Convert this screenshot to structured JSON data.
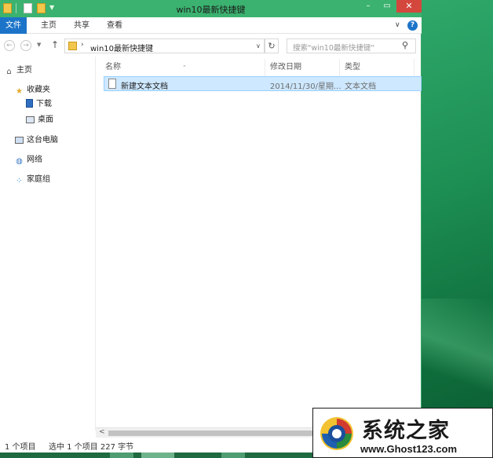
{
  "window": {
    "title": "win10最新快捷键",
    "controls": {
      "minimize": "–",
      "maximize": "▭",
      "close": "✕"
    },
    "accent": "#3bb26f"
  },
  "ribbon": {
    "tabs": [
      {
        "label": "文件",
        "active": true
      },
      {
        "label": "主页"
      },
      {
        "label": "共享"
      },
      {
        "label": "查看"
      }
    ],
    "expand_icon": "chevron-down-icon",
    "help_icon": "?"
  },
  "address_bar": {
    "path": "win10最新快捷键",
    "separator": "›",
    "search_placeholder": "搜索\"win10最新快捷键\""
  },
  "sidebar": {
    "items": [
      {
        "label": "主页",
        "icon": "home-icon"
      },
      {
        "label": "收藏夹",
        "icon": "star-icon"
      },
      {
        "label": "下载",
        "icon": "download-folder-icon"
      },
      {
        "label": "桌面",
        "icon": "desktop-icon"
      },
      {
        "label": "这台电脑",
        "icon": "computer-icon"
      },
      {
        "label": "网络",
        "icon": "network-icon"
      },
      {
        "label": "家庭组",
        "icon": "homegroup-icon"
      }
    ]
  },
  "file_list": {
    "columns": [
      "名称",
      "修改日期",
      "类型"
    ],
    "rows": [
      {
        "name": "新建文本文档",
        "date": "2014/11/30/星期...",
        "type": "文本文档",
        "selected": true
      }
    ]
  },
  "status_bar": {
    "items": "1 个项目",
    "selected": "选中 1 个项目 227 字节"
  },
  "watermark": {
    "title": "系统之家",
    "url": "www.Ghost123.com"
  }
}
